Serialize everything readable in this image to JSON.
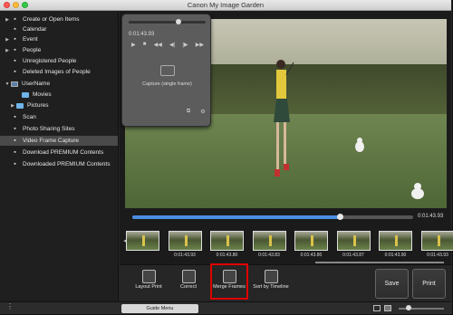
{
  "window": {
    "title": "Canon My Image Garden"
  },
  "sidebar": {
    "items": [
      {
        "label": "Create or Open Items",
        "icon": "create-items-icon",
        "arrow": "▶"
      },
      {
        "label": "Calendar",
        "icon": "calendar-icon",
        "arrow": ""
      },
      {
        "label": "Event",
        "icon": "event-icon",
        "arrow": "▶"
      },
      {
        "label": "People",
        "icon": "people-icon",
        "arrow": "▶"
      },
      {
        "label": "Unregistered People",
        "icon": "unregistered-people-icon",
        "arrow": ""
      },
      {
        "label": "Deleted Images of People",
        "icon": "deleted-people-icon",
        "arrow": ""
      },
      {
        "label": "UserName",
        "icon": "computer-icon",
        "arrow": "▼"
      },
      {
        "label": "Movies",
        "icon": "folder-icon",
        "arrow": ""
      },
      {
        "label": "Pictures",
        "icon": "folder-icon",
        "arrow": "▶"
      },
      {
        "label": "Scan",
        "icon": "scan-icon",
        "arrow": ""
      },
      {
        "label": "Photo Sharing Sites",
        "icon": "photo-sharing-icon",
        "arrow": ""
      },
      {
        "label": "Video Frame Capture",
        "icon": "video-frame-icon",
        "arrow": "",
        "selected": true
      },
      {
        "label": "Download PREMIUM Contents",
        "icon": "download-icon",
        "arrow": ""
      },
      {
        "label": "Downloaded PREMIUM Contents",
        "icon": "downloaded-icon",
        "arrow": ""
      }
    ]
  },
  "capture_panel": {
    "time": "0:01:43.93",
    "label": "Capture (single frame)"
  },
  "seekbar": {
    "time": "0:01:43.93",
    "progress": 0.74
  },
  "frames": [
    {
      "time": ""
    },
    {
      "time": "0:01:43.93"
    },
    {
      "time": "0:01:43.80"
    },
    {
      "time": "0:01:43.83"
    },
    {
      "time": "0:01:43.80"
    },
    {
      "time": "0:01:43.87"
    },
    {
      "time": "0:01:43.90"
    },
    {
      "time": "0:01:43.93"
    }
  ],
  "toolbar": {
    "layout_print": "Layout Print",
    "correct": "Correct",
    "merge_frames": "Merge Frames",
    "sort_by_timeline": "Sort by Timeline",
    "save": "Save",
    "print": "Print"
  },
  "statusbar": {
    "guide_menu": "Guide Menu"
  },
  "colors": {
    "highlight": "#e00000",
    "selected_item": "#4a4a4a",
    "seek_fill": "#4b8ee0"
  }
}
